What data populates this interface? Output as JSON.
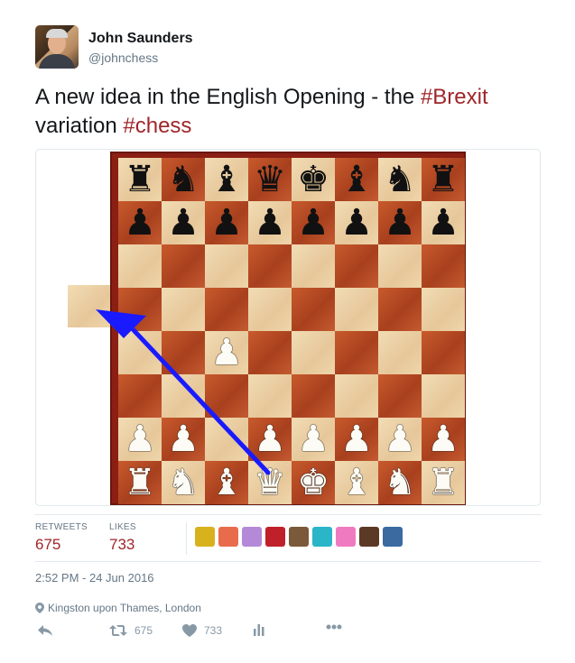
{
  "author": {
    "name": "John Saunders",
    "handle": "@johnchess"
  },
  "tweet": {
    "text_parts": [
      {
        "t": "A new idea in the English Opening - the ",
        "hashtag": false
      },
      {
        "t": "#Brexit",
        "hashtag": true
      },
      {
        "t": " variation ",
        "hashtag": false
      },
      {
        "t": "#chess",
        "hashtag": true
      }
    ]
  },
  "media": {
    "board_rows": [
      [
        "r",
        "n",
        "b",
        "q",
        "k",
        "b",
        "n",
        "r"
      ],
      [
        "p",
        "p",
        "p",
        "p",
        "p",
        "p",
        "p",
        "p"
      ],
      [
        "",
        "",
        "",
        "",
        "",
        "",
        "",
        ""
      ],
      [
        "",
        "",
        "",
        "",
        "",
        "",
        "",
        ""
      ],
      [
        "",
        "",
        "P",
        "",
        "",
        "",
        "",
        ""
      ],
      [
        "",
        "",
        "",
        "",
        "",
        "",
        "",
        ""
      ],
      [
        "P",
        "P",
        "",
        "P",
        "P",
        "P",
        "P",
        "P"
      ],
      [
        "R",
        "N",
        "B",
        "Q",
        "K",
        "B",
        "N",
        "R"
      ]
    ],
    "arrow_color": "#1a1aff"
  },
  "stats": {
    "retweets_label": "RETWEETS",
    "retweets_value": "675",
    "likes_label": "LIKES",
    "likes_value": "733",
    "liker_colors": [
      "#d7b21d",
      "#e86c4c",
      "#b48ad8",
      "#c0202a",
      "#7a5a3a",
      "#2ab5c8",
      "#f07ac0",
      "#5a3a24",
      "#3a6aa0"
    ]
  },
  "timestamp": "2:52 PM - 24 Jun 2016",
  "location": "Kingston upon Thames, London",
  "actions": {
    "retweet_count": "675",
    "like_count": "733"
  },
  "colors": {
    "hashtag": "#a0262a",
    "muted": "#657786"
  }
}
